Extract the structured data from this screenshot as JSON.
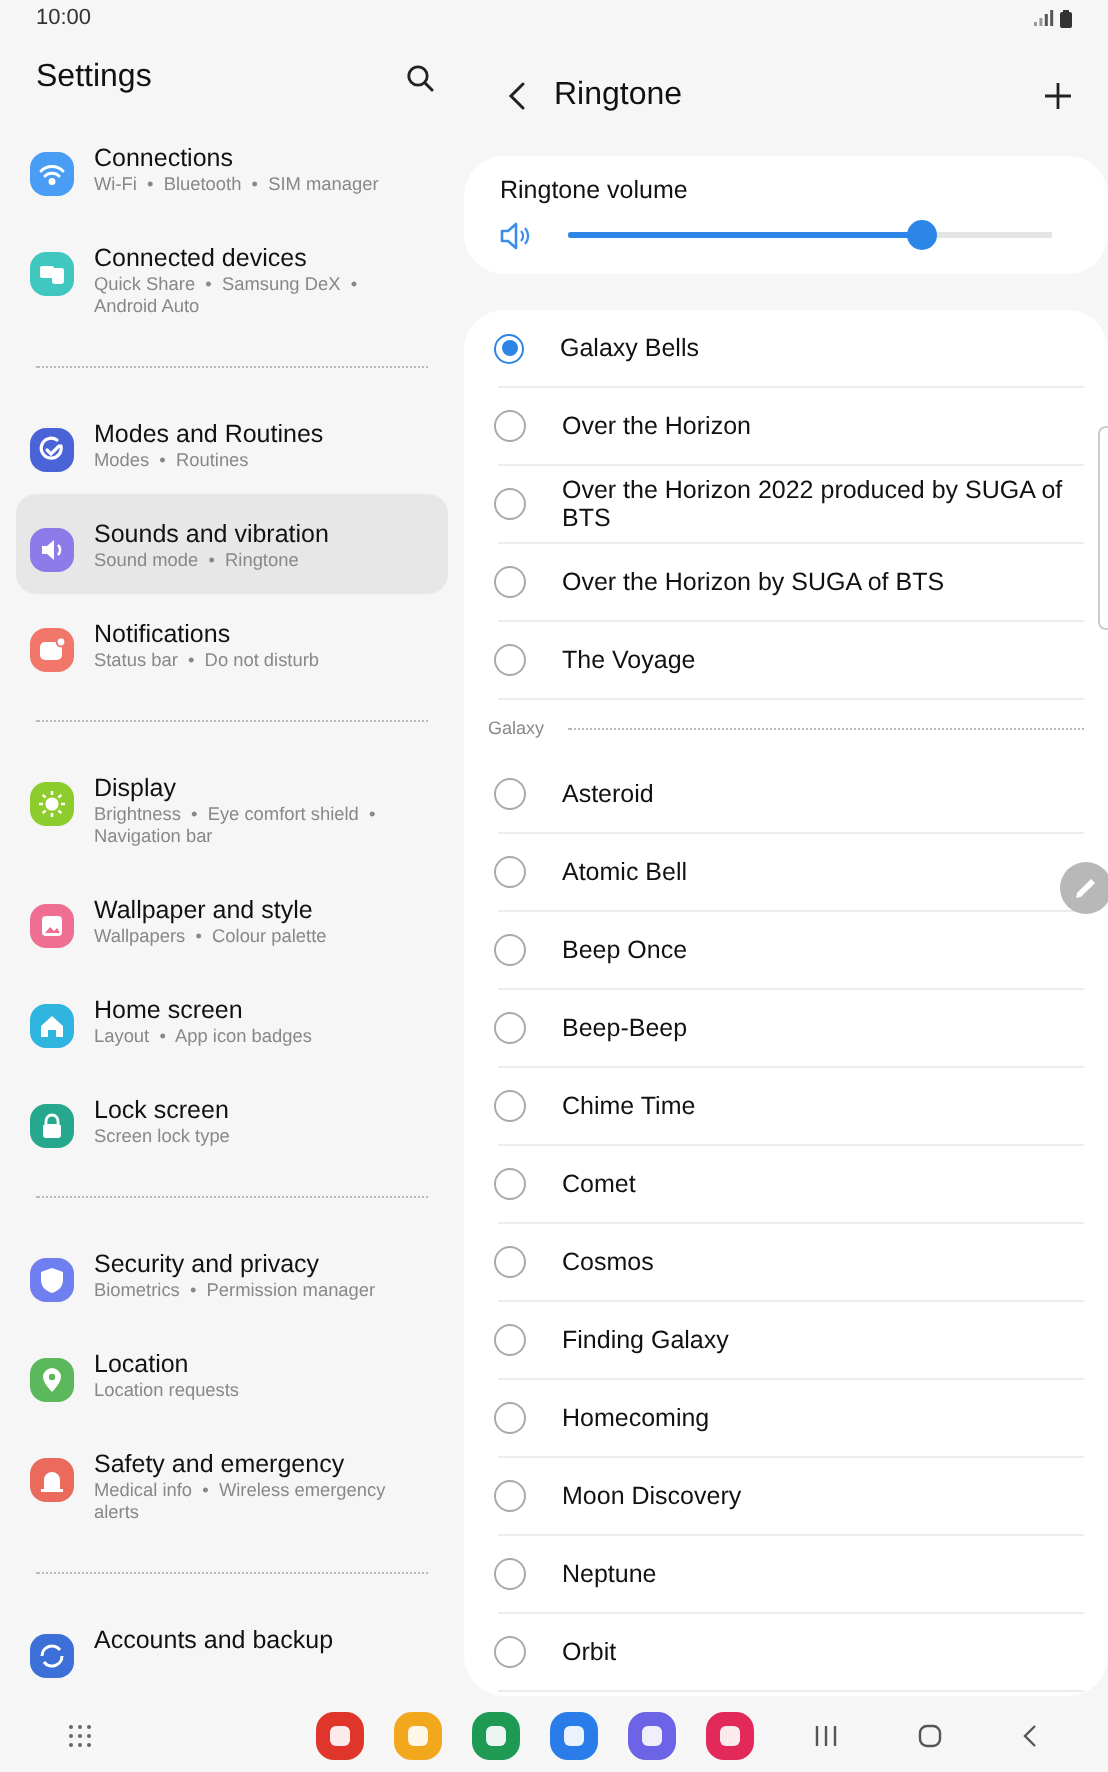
{
  "status_bar": {
    "time": "10:00"
  },
  "settings": {
    "title": "Settings",
    "groups": [
      {
        "items": [
          {
            "title": "Connections",
            "subtitle": "Wi-Fi  •  Bluetooth  •  SIM manager",
            "kind": "wifi",
            "color": "#4a9df5",
            "selected": false
          },
          {
            "title": "Connected devices",
            "subtitle": "Quick Share  •  Samsung DeX  •  Android Auto",
            "kind": "devices",
            "color": "#3fc7c0",
            "selected": false
          }
        ]
      },
      {
        "items": [
          {
            "title": "Modes and Routines",
            "subtitle": "Modes  •  Routines",
            "kind": "check",
            "color": "#4a63d6",
            "selected": false
          },
          {
            "title": "Sounds and vibration",
            "subtitle": "Sound mode  •  Ringtone",
            "kind": "sound",
            "color": "#8c7be8",
            "selected": true
          },
          {
            "title": "Notifications",
            "subtitle": "Status bar  •  Do not disturb",
            "kind": "bell",
            "color": "#f0776a",
            "selected": false
          }
        ]
      },
      {
        "items": [
          {
            "title": "Display",
            "subtitle": "Brightness  •  Eye comfort shield  •  Navigation bar",
            "kind": "sun",
            "color": "#8ccc2c",
            "selected": false
          },
          {
            "title": "Wallpaper and style",
            "subtitle": "Wallpapers  •  Colour palette",
            "kind": "image",
            "color": "#ef6f93",
            "selected": false
          },
          {
            "title": "Home screen",
            "subtitle": "Layout  •  App icon badges",
            "kind": "home",
            "color": "#2fb5e0",
            "selected": false
          },
          {
            "title": "Lock screen",
            "subtitle": "Screen lock type",
            "kind": "lock",
            "color": "#26a88e",
            "selected": false
          }
        ]
      },
      {
        "items": [
          {
            "title": "Security and privacy",
            "subtitle": "Biometrics  •  Permission manager",
            "kind": "shield",
            "color": "#6f7ff0",
            "selected": false
          },
          {
            "title": "Location",
            "subtitle": "Location requests",
            "kind": "pin",
            "color": "#5cb85c",
            "selected": false
          },
          {
            "title": "Safety and emergency",
            "subtitle": "Medical info  •  Wireless emergency alerts",
            "kind": "alert",
            "color": "#ea6a5c",
            "selected": false
          }
        ]
      },
      {
        "items": [
          {
            "title": "Accounts and backup",
            "kind": "sync",
            "color": "#3d6fd9",
            "selected": false
          }
        ]
      }
    ]
  },
  "ringtone": {
    "title": "Ringtone",
    "volume": {
      "label": "Ringtone volume",
      "level": 0.73
    },
    "sections": [
      {
        "items": [
          {
            "name": "Galaxy Bells",
            "selected": true
          },
          {
            "name": "Over the Horizon",
            "selected": false
          },
          {
            "name": "Over the Horizon 2022 produced by SUGA of BTS",
            "selected": false
          },
          {
            "name": "Over the Horizon by SUGA of BTS",
            "selected": false
          },
          {
            "name": "The Voyage",
            "selected": false
          }
        ]
      },
      {
        "header": "Galaxy",
        "items": [
          {
            "name": "Asteroid",
            "selected": false
          },
          {
            "name": "Atomic Bell",
            "selected": false
          },
          {
            "name": "Beep Once",
            "selected": false
          },
          {
            "name": "Beep-Beep",
            "selected": false
          },
          {
            "name": "Chime Time",
            "selected": false
          },
          {
            "name": "Comet",
            "selected": false
          },
          {
            "name": "Cosmos",
            "selected": false
          },
          {
            "name": "Finding Galaxy",
            "selected": false
          },
          {
            "name": "Homecoming",
            "selected": false
          },
          {
            "name": "Moon Discovery",
            "selected": false
          },
          {
            "name": "Neptune",
            "selected": false
          },
          {
            "name": "Orbit",
            "selected": false
          }
        ]
      }
    ]
  },
  "dock": {
    "apps": [
      {
        "color": "#e0352b"
      },
      {
        "color": "#f2a81d"
      },
      {
        "color": "#1f9a54"
      },
      {
        "color": "#2a7ce8"
      },
      {
        "color": "#6c63e6"
      },
      {
        "color": "#e3285a"
      }
    ]
  }
}
